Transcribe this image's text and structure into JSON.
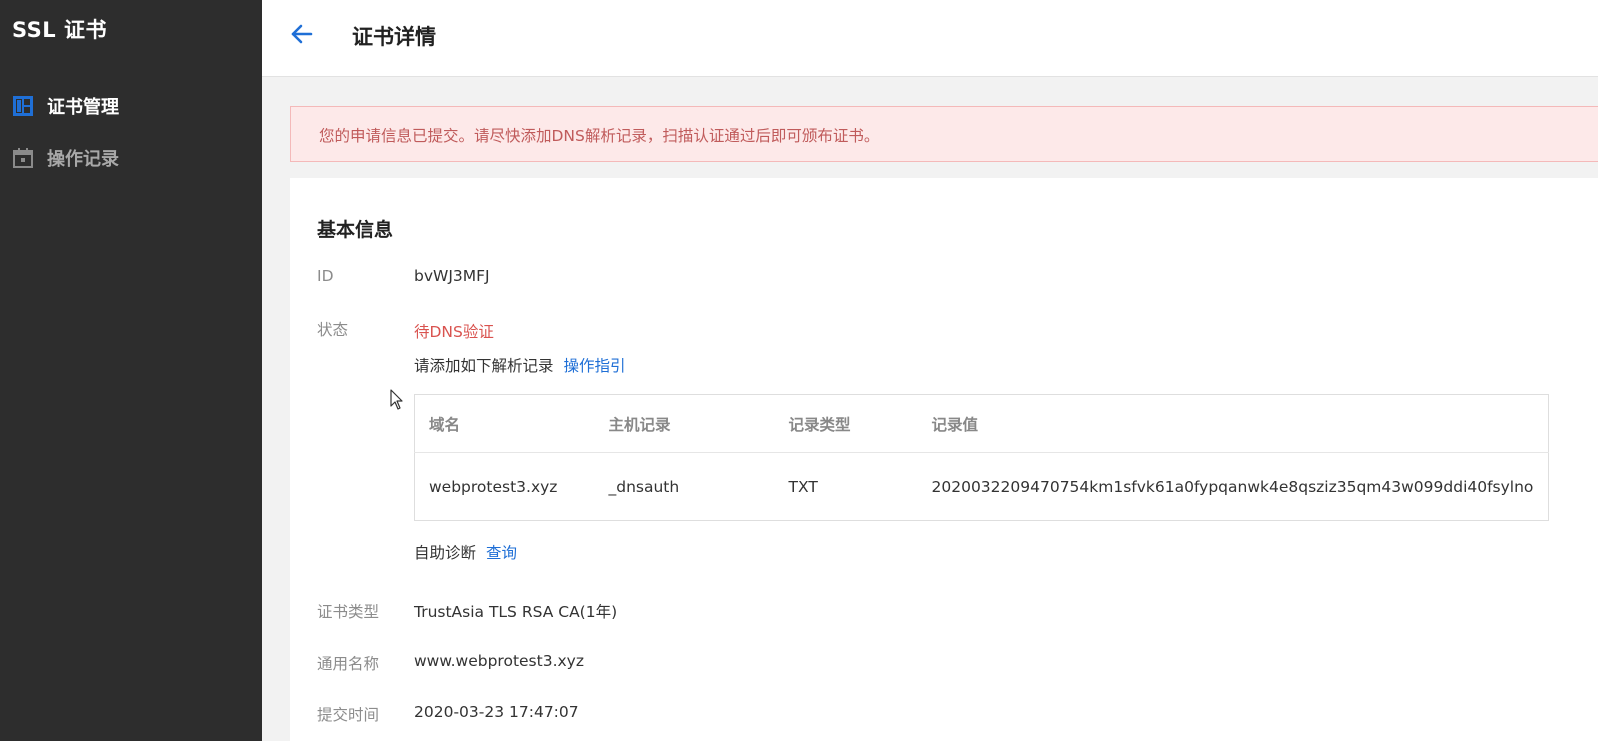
{
  "sidebar": {
    "brand": "SSL 证书",
    "items": [
      {
        "label": "证书管理",
        "icon": "certificate-icon",
        "active": true
      },
      {
        "label": "操作记录",
        "icon": "calendar-icon",
        "active": false
      }
    ]
  },
  "header": {
    "back_icon": "arrow-left-icon",
    "title": "证书详情"
  },
  "alert": {
    "text": "您的申请信息已提交。请尽快添加DNS解析记录，扫描认证通过后即可颁布证书。"
  },
  "basic_info": {
    "section_title": "基本信息",
    "id_label": "ID",
    "id_value": "bvWJ3MFJ",
    "status_label": "状态",
    "status_value": "待DNS验证",
    "dns_instruction": "请添加如下解析记录",
    "dns_guide_link": "操作指引",
    "dns_table": {
      "headers": [
        "域名",
        "主机记录",
        "记录类型",
        "记录值"
      ],
      "row": [
        "webprotest3.xyz",
        "_dnsauth",
        "TXT",
        "2020032209470754km1sfvk61a0fypqanwk4e8qsziz35qm43w099ddi40fsylno"
      ]
    },
    "self_diag_label": "自助诊断",
    "self_diag_link": "查询",
    "cert_type_label": "证书类型",
    "cert_type_value": "TrustAsia TLS RSA CA(1年)",
    "common_name_label": "通用名称",
    "common_name_value": "www.webprotest3.xyz",
    "submit_time_label": "提交时间",
    "submit_time_value": "2020-03-23 17:47:07"
  },
  "colors": {
    "sidebar_bg": "#2d2d2d",
    "accent_blue": "#1f6fd6",
    "alert_bg": "#fde9e9",
    "alert_text": "#c05b5b",
    "status_red": "#d9534f"
  }
}
